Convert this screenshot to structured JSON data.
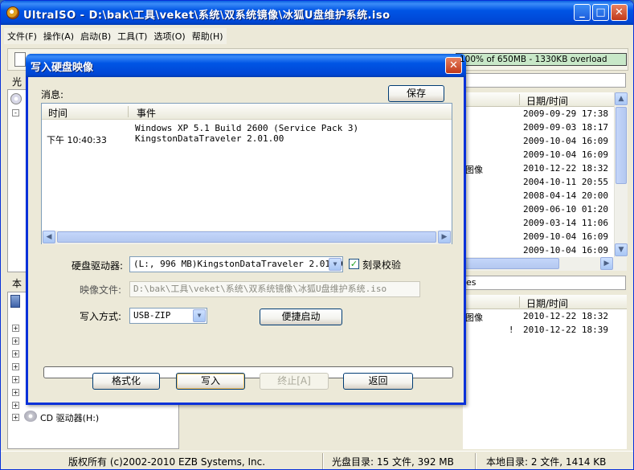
{
  "window": {
    "title": "UltraISO - D:\\bak\\工具\\veket\\系统\\双系统镜像\\冰狐U盘维护系统.iso",
    "minimize": "_",
    "maximize": "□",
    "close": "✕"
  },
  "menu": [
    "文件(F)",
    "操作(A)",
    "启动(B)",
    "工具(T)",
    "选项(O)",
    "帮助(H)"
  ],
  "capacity": {
    "text": "100% of 650MB - 1330KB overload",
    "fill_fraction": 1.0
  },
  "left_top_label": "光",
  "left_bottom_label": "本",
  "top_list": {
    "date_header": "日期/时间",
    "rows": [
      {
        "name": "",
        "date": "2009-09-29 17:38"
      },
      {
        "name": "",
        "date": "2009-09-03 18:17"
      },
      {
        "name": "",
        "date": "2009-10-04 16:09"
      },
      {
        "name": "",
        "date": "2009-10-04 16:09"
      },
      {
        "name": "图像",
        "date": "2010-12-22 18:32"
      },
      {
        "name": "",
        "date": "2004-10-11 20:55"
      },
      {
        "name": "",
        "date": "2008-04-14 20:00"
      },
      {
        "name": "",
        "date": "2009-06-10 01:20"
      },
      {
        "name": "",
        "date": "2009-03-14 11:06"
      },
      {
        "name": "",
        "date": "2009-10-04 16:09"
      },
      {
        "name": "",
        "date": "2009-10-04 16:09"
      }
    ]
  },
  "bottom_path_tail": "es",
  "bottom_list": {
    "date_header": "日期/时间",
    "rows": [
      {
        "name": "图像",
        "flag": "",
        "date": "2010-12-22 18:32"
      },
      {
        "name": "",
        "flag": "!",
        "date": "2010-12-22 18:39"
      }
    ]
  },
  "tree": {
    "cd_drive_label": "CD 驱动器(H:)"
  },
  "statusbar": {
    "copyright": "版权所有 (c)2002-2010 EZB Systems, Inc.",
    "disc_dir": "光盘目录: 15 文件, 392 MB",
    "local_dir": "本地目录: 2 文件, 1414 KB"
  },
  "dialog": {
    "title": "写入硬盘映像",
    "close": "✕",
    "messages_label": "消息:",
    "save_button": "保存",
    "msg_columns": [
      "时间",
      "事件"
    ],
    "messages": [
      {
        "time": "",
        "event": "Windows XP 5.1 Build 2600 (Service Pack 3)"
      },
      {
        "time": "下午 10:40:33",
        "event": "KingstonDataTraveler 2.01.00"
      }
    ],
    "drive_label": "硬盘驱动器:",
    "drive_value": "(L:, 996 MB)KingstonDataTraveler 2.01.00",
    "verify_label": "刻录校验",
    "verify_checked": true,
    "image_label": "映像文件:",
    "image_value": "D:\\bak\\工具\\veket\\系统\\双系统镜像\\冰狐U盘维护系统.iso",
    "write_mode_label": "写入方式:",
    "write_mode_value": "USB-ZIP",
    "quickboot_button": "便捷启动",
    "progress": 0,
    "buttons": {
      "format": "格式化",
      "write": "写入",
      "abort": "终止[A]",
      "back": "返回"
    }
  }
}
